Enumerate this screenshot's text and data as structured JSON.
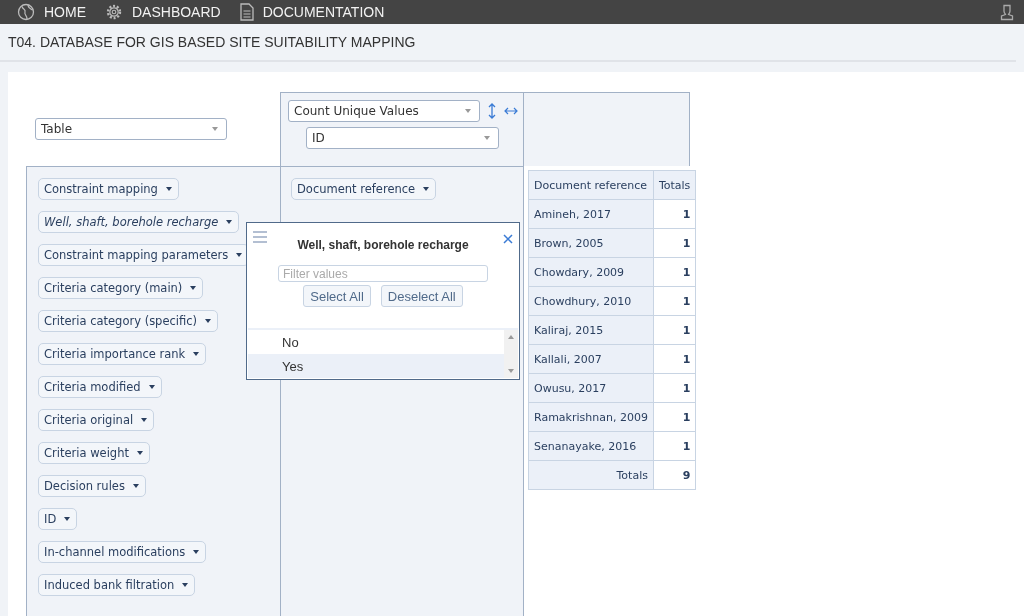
{
  "nav": [
    {
      "label": "HOME",
      "kind": "globe"
    },
    {
      "label": "DASHBOARD",
      "kind": "gear"
    },
    {
      "label": "DOCUMENTATION",
      "kind": "document"
    }
  ],
  "page_title": "T04. DATABASE FOR GIS BASED SITE SUITABILITY MAPPING",
  "renderer": "Table",
  "aggregator": "Count Unique Values",
  "aggregator_attribute": "ID",
  "column_fields": [
    {
      "label": "Document reference",
      "filtered": false
    }
  ],
  "unused_fields": [
    {
      "label": "Constraint mapping",
      "filtered": false
    },
    {
      "label": "Well, shaft, borehole recharge",
      "filtered": true
    },
    {
      "label": "Constraint mapping parameters",
      "filtered": false
    },
    {
      "label": "Criteria category (main)",
      "filtered": false
    },
    {
      "label": "Criteria category (specific)",
      "filtered": false
    },
    {
      "label": "Criteria importance rank",
      "filtered": false
    },
    {
      "label": "Criteria modified",
      "filtered": false
    },
    {
      "label": "Criteria original",
      "filtered": false
    },
    {
      "label": "Criteria weight",
      "filtered": false
    },
    {
      "label": "Decision rules",
      "filtered": false
    },
    {
      "label": "ID",
      "filtered": false
    },
    {
      "label": "In-channel modifications",
      "filtered": false
    },
    {
      "label": "Induced bank filtration",
      "filtered": false
    }
  ],
  "filter_popup": {
    "title": "Well, shaft, borehole recharge",
    "placeholder": "Filter values",
    "buttons": [
      "Select All",
      "Deselect All"
    ],
    "values": [
      {
        "label": "No",
        "selected": false
      },
      {
        "label": "Yes",
        "selected": true
      }
    ]
  },
  "table": {
    "columns": [
      "Document reference",
      "Totals"
    ],
    "rows": [
      {
        "label": "Amineh, 2017",
        "value": "1"
      },
      {
        "label": "Brown, 2005",
        "value": "1"
      },
      {
        "label": "Chowdary, 2009",
        "value": "1"
      },
      {
        "label": "Chowdhury, 2010",
        "value": "1"
      },
      {
        "label": "Kaliraj, 2015",
        "value": "1"
      },
      {
        "label": "Kallali, 2007",
        "value": "1"
      },
      {
        "label": "Owusu, 2017",
        "value": "1"
      },
      {
        "label": "Ramakrishnan, 2009",
        "value": "1"
      },
      {
        "label": "Senanayake, 2016",
        "value": "1"
      }
    ],
    "totals": {
      "label": "Totals",
      "value": "9"
    }
  }
}
